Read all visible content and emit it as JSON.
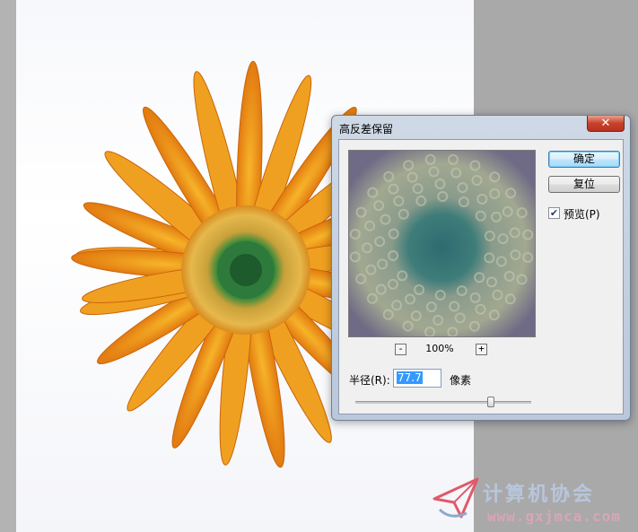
{
  "dialog": {
    "title": "高反差保留",
    "close_symbol": "✕",
    "ok_label": "确定",
    "reset_label": "复位",
    "preview_label": "预览(P)",
    "preview_checked": true,
    "zoom_minus": "-",
    "zoom_plus": "+",
    "zoom_level": "100%",
    "radius_label": "半径(R):",
    "radius_value": "77.7",
    "radius_unit": "像素",
    "slider_fraction": 0.77
  },
  "icons": {
    "close": "close-icon",
    "check": "check-icon",
    "logo": "paper-plane-logo-icon"
  },
  "watermark": {
    "name": "计算机协会",
    "url": "www.gxjmca.com"
  },
  "colors": {
    "petal": "#f29a1c",
    "petal_dark": "#d9660a",
    "center": "#2f7a3e",
    "close_button": "#c7412b",
    "selection": "#3399ff"
  }
}
